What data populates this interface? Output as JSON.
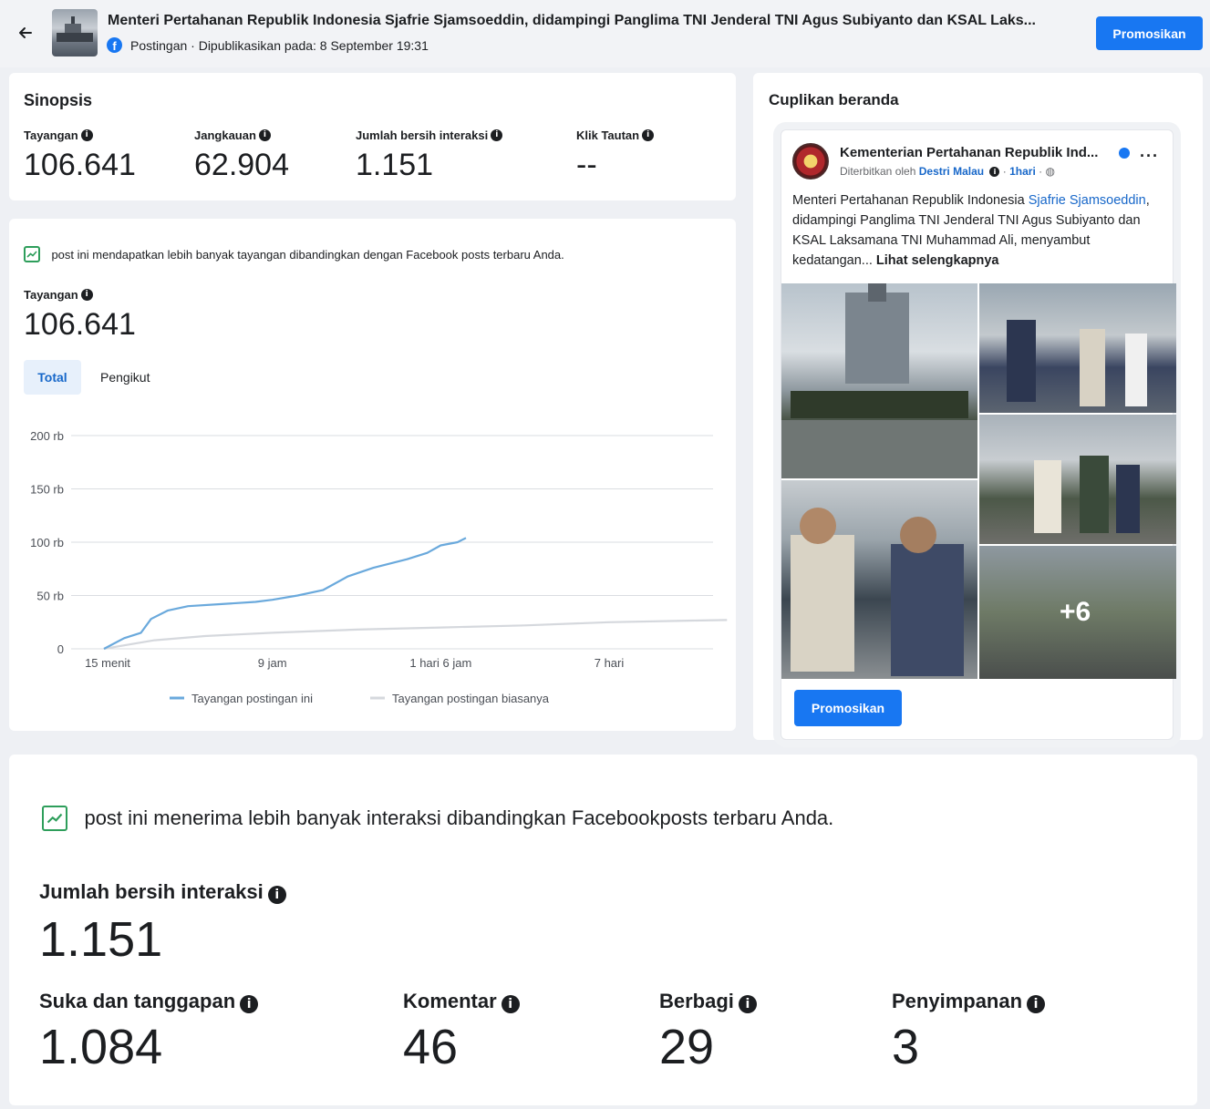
{
  "header": {
    "back_icon": "arrow-left-icon",
    "title": "Menteri Pertahanan Republik Indonesia Sjafrie Sjamsoeddin, didampingi Panglima TNI Jenderal TNI Agus Subiyanto dan KSAL Laks...",
    "platform_icon": "facebook-icon",
    "meta": "Postingan · Dipublikasikan pada: 8 September 19:31",
    "promote_label": "Promosikan"
  },
  "synopsis": {
    "title": "Sinopsis",
    "metrics": [
      {
        "label": "Tayangan",
        "value": "106.641"
      },
      {
        "label": "Jangkauan",
        "value": "62.904"
      },
      {
        "label": "Jumlah bersih interaksi",
        "value": "1.151"
      },
      {
        "label": "Klik Tautan",
        "value": "--"
      }
    ]
  },
  "views_panel": {
    "insight": "post ini mendapatkan lebih banyak tayangan dibandingkan dengan Facebook posts terbaru Anda.",
    "metric_label": "Tayangan",
    "metric_value": "106.641",
    "tabs": [
      {
        "label": "Total",
        "active": true
      },
      {
        "label": "Pengikut",
        "active": false
      }
    ]
  },
  "chart_data": {
    "type": "line",
    "title": "",
    "xlabel": "",
    "ylabel": "",
    "x_ticks": [
      "15 menit",
      "9 jam",
      "1 hari 6 jam",
      "7 hari"
    ],
    "y_ticks": [
      "0",
      "50 rb",
      "100 rb",
      "150 rb",
      "200 rb"
    ],
    "ylim": [
      0,
      200000
    ],
    "grid": true,
    "legend_position": "bottom",
    "series": [
      {
        "name": "Tayangan postingan ini",
        "color": "#6aa9dc",
        "points": [
          [
            0,
            0
          ],
          [
            0.12,
            10000
          ],
          [
            0.22,
            15000
          ],
          [
            0.28,
            28000
          ],
          [
            0.38,
            36000
          ],
          [
            0.5,
            40000
          ],
          [
            0.7,
            42000
          ],
          [
            0.9,
            44000
          ],
          [
            1.0,
            46000
          ],
          [
            1.15,
            50000
          ],
          [
            1.3,
            55000
          ],
          [
            1.45,
            68000
          ],
          [
            1.6,
            76000
          ],
          [
            1.8,
            84000
          ],
          [
            1.92,
            90000
          ],
          [
            2.0,
            97000
          ],
          [
            2.1,
            100000
          ],
          [
            2.15,
            104000
          ]
        ]
      },
      {
        "name": "Tayangan postingan biasanya",
        "color": "#d5d8dd",
        "points": [
          [
            0,
            0
          ],
          [
            0.3,
            8000
          ],
          [
            0.6,
            12000
          ],
          [
            1.0,
            15000
          ],
          [
            1.5,
            18000
          ],
          [
            2.0,
            20000
          ],
          [
            2.5,
            22000
          ],
          [
            3.0,
            25000
          ],
          [
            3.5,
            26500
          ],
          [
            3.7,
            27000
          ]
        ]
      }
    ]
  },
  "preview": {
    "title": "Cuplikan beranda",
    "page_name": "Kementerian Pertahanan Republik Ind...",
    "published_by_prefix": "Diterbitkan oleh",
    "published_by": "Destri Malau",
    "time": "1hari",
    "text_before": "Menteri Pertahanan Republik Indonesia ",
    "text_link": "Sjafrie Sjamsoeddin",
    "text_after": ", didampingi Panglima TNI Jenderal TNI Agus Subiyanto dan KSAL Laksamana TNI Muhammad Ali, menyambut kedatangan... ",
    "see_more": "Lihat selengkapnya",
    "more_photos": "+6",
    "promote_label": "Promosikan"
  },
  "interactions": {
    "insight": "post ini menerima lebih banyak interaksi dibandingkan Facebookposts terbaru Anda.",
    "total_label": "Jumlah bersih interaksi",
    "total_value": "1.151",
    "breakdown": [
      {
        "label": "Suka dan tanggapan",
        "value": "1.084"
      },
      {
        "label": "Komentar",
        "value": "46"
      },
      {
        "label": "Berbagi",
        "value": "29"
      },
      {
        "label": "Penyimpanan",
        "value": "3"
      }
    ]
  }
}
